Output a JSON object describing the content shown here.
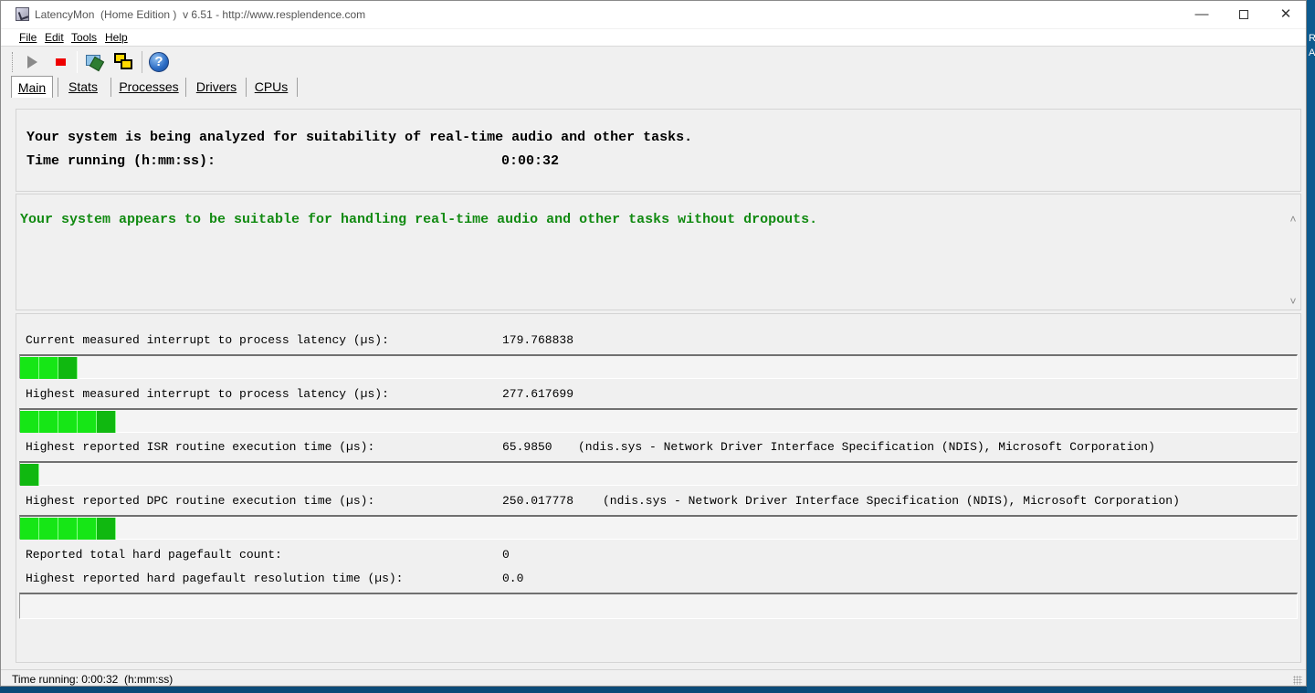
{
  "window": {
    "title": "LatencyMon  (Home Edition )  v 6.51 - http://www.resplendence.com",
    "minimize_glyph": "—",
    "close_glyph": "✕"
  },
  "menu": [
    "File",
    "Edit",
    "Tools",
    "Help"
  ],
  "toolbar": {
    "buttons": [
      "play-icon",
      "stop-icon",
      "drivers-icon",
      "windows-icon",
      "help-icon"
    ],
    "help_glyph": "?"
  },
  "tabs": [
    "Main",
    "Stats",
    "Processes",
    "Drivers",
    "CPUs"
  ],
  "active_tab": "Main",
  "analysis": {
    "line1": "Your system is being analyzed for suitability of real-time audio and other tasks.",
    "time_label": "Time running (h:mm:ss):",
    "time_value": "0:00:32"
  },
  "verdict": {
    "text": "Your system appears to be suitable for handling real-time audio and other tasks without dropouts.",
    "color": "#118a11",
    "scroll_up": "˄",
    "scroll_down": "˅"
  },
  "metrics": {
    "current_latency": {
      "label": "Current measured interrupt to process latency (µs):",
      "value": "179.768838",
      "bar_segments": 3
    },
    "highest_latency": {
      "label": "Highest measured interrupt to process latency (µs):",
      "value": "277.617699",
      "bar_segments": 5
    },
    "isr": {
      "label": "Highest reported ISR routine execution time (µs):",
      "value": "65.9850",
      "detail": "(ndis.sys - Network Driver Interface Specification (NDIS), Microsoft Corporation)",
      "bar_segments": 1
    },
    "dpc": {
      "label": "Highest reported DPC routine execution time (µs):",
      "value": "250.017778",
      "detail": "(ndis.sys - Network Driver Interface Specification (NDIS), Microsoft Corporation)",
      "bar_segments": 5
    },
    "pagefault_count": {
      "label": "Reported total hard pagefault count:",
      "value": "0"
    },
    "pagefault_time": {
      "label": "Highest reported hard pagefault resolution time (µs):",
      "value": "0.0",
      "bar_segments": 0
    }
  },
  "statusbar": {
    "text": "Time running: 0:00:32  (h:mm:ss)"
  },
  "desktop": {
    "edge_text": [
      "R",
      "A"
    ]
  }
}
